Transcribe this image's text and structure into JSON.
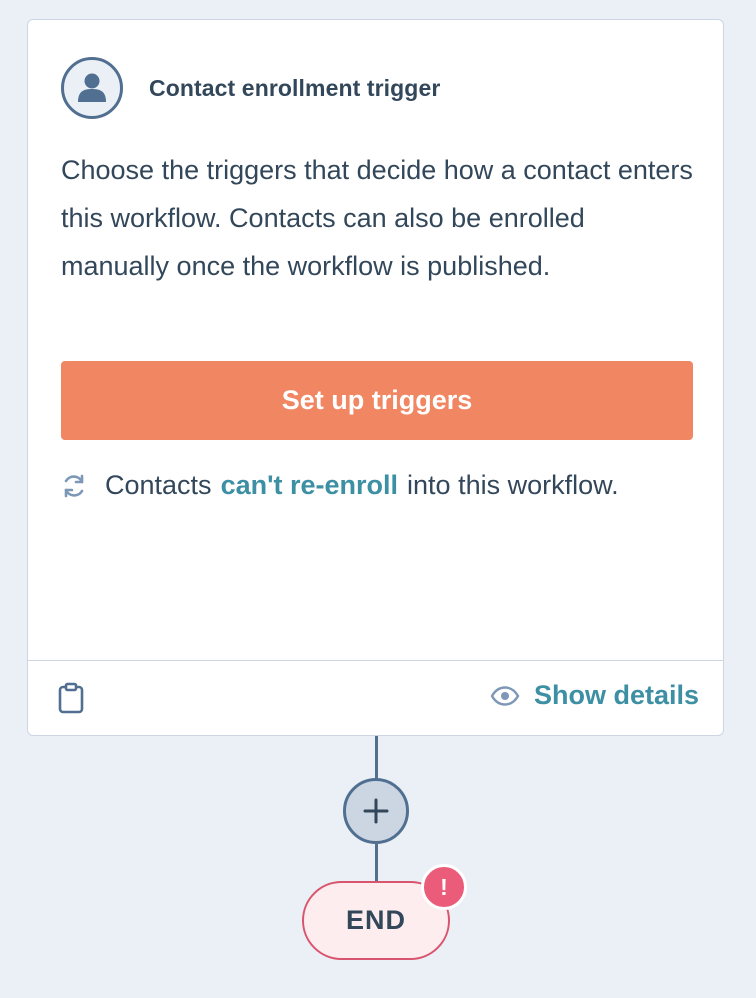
{
  "trigger_card": {
    "title": "Contact enrollment trigger",
    "avatar_icon": "contact-avatar-icon",
    "description": "Choose the triggers that decide how a contact enters this workflow. Contacts can also be enrolled manually once the workflow is published.",
    "setup_button_label": "Set up triggers",
    "reenroll": {
      "icon": "refresh-icon",
      "prefix": "Contacts",
      "link_text": "can't re-enroll",
      "suffix": "into this workflow."
    },
    "footer": {
      "clipboard_icon": "clipboard-icon",
      "eye_icon": "eye-icon",
      "show_details_label": "Show details"
    }
  },
  "flow": {
    "add_action_icon": "plus-icon",
    "end_label": "END",
    "error_badge": "!"
  },
  "colors": {
    "background": "#eaf0f6",
    "text": "#33475b",
    "button": "#f08662",
    "link": "#3d8fa3",
    "end_border": "#d9556e",
    "end_fill": "#fdedee",
    "error_badge": "#ea5c79"
  }
}
